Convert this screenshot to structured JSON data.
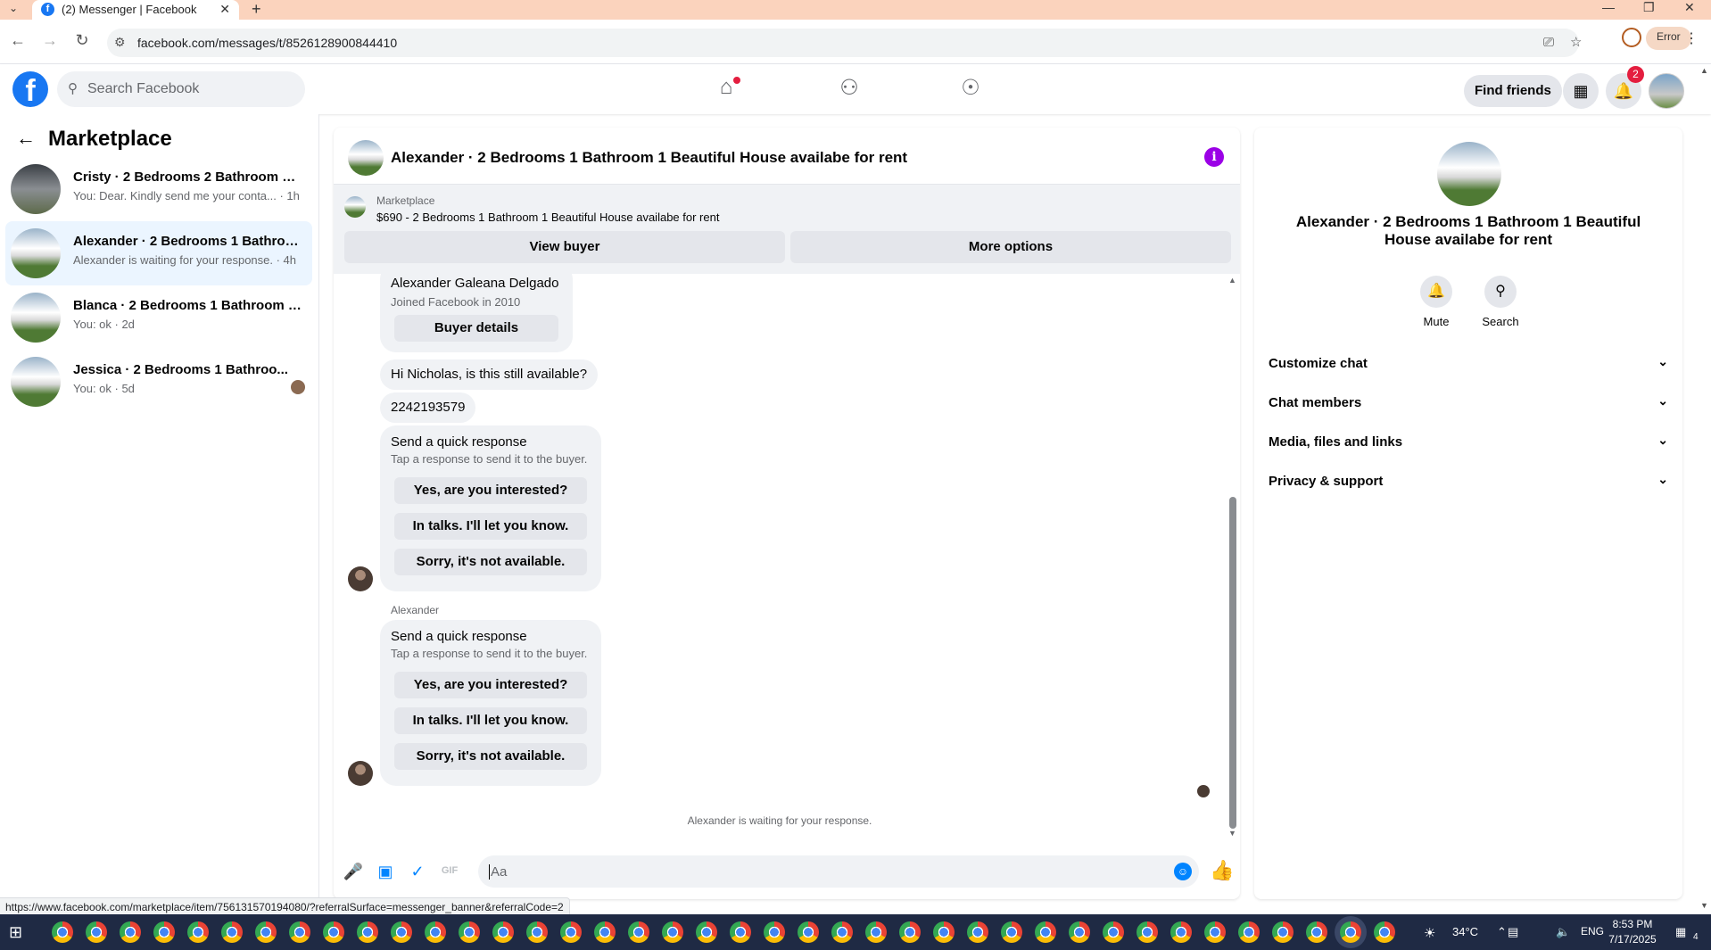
{
  "browser": {
    "tab_title": "(2) Messenger | Facebook",
    "url": "facebook.com/messages/t/8526128900844410",
    "error_label": "Error",
    "status_url": "https://www.facebook.com/marketplace/item/756131570194080/?referralSurface=messenger_banner&referralCode=2"
  },
  "fb_header": {
    "search_placeholder": "Search Facebook",
    "find_friends": "Find friends",
    "notification_count": "2"
  },
  "sidebar": {
    "title": "Marketplace",
    "conversations": [
      {
        "name": "Cristy · 2 Bedrooms 2 Bathroom 1 ...",
        "preview": "You: Dear. Kindly send me your conta... · 1h"
      },
      {
        "name": "Alexander · 2 Bedrooms 1 Bathroo...",
        "preview": "Alexander is waiting for your response. · 4h"
      },
      {
        "name": "Blanca · 2 Bedrooms 1 Bathroom 1 ...",
        "preview": "You: ok · 2d"
      },
      {
        "name": "Jessica · 2 Bedrooms 1 Bathroo...",
        "preview": "You: ok · 5d"
      }
    ]
  },
  "chat": {
    "title": "Alexander · 2 Bedrooms 1 Bathroom 1 Beautiful House availabe for rent",
    "banner": {
      "source": "Marketplace",
      "description": "$690 - 2 Bedrooms 1 Bathroom 1 Beautiful House availabe for rent",
      "view_buyer": "View buyer",
      "more_options": "More options"
    },
    "buyer_card": {
      "name": "Alexander Galeana Delgado",
      "joined": "Joined Facebook in 2010",
      "button": "Buyer details"
    },
    "messages": [
      "Hi Nicholas, is this still available?",
      "2242193579"
    ],
    "quick_response": {
      "title": "Send a quick response",
      "subtitle": "Tap a response to send it to the buyer.",
      "options": [
        "Yes, are you interested?",
        "In talks. I'll let you know.",
        "Sorry, it's not available."
      ]
    },
    "sender_name": "Alexander",
    "waiting": "Alexander is waiting for your response.",
    "composer_placeholder": "Aa",
    "gif_label": "GIF"
  },
  "info_panel": {
    "title": "Alexander · 2 Bedrooms 1 Bathroom 1 Beautiful House availabe for rent",
    "actions": [
      "Mute",
      "Search"
    ],
    "sections": [
      "Customize chat",
      "Chat members",
      "Media, files and links",
      "Privacy & support"
    ]
  },
  "taskbar": {
    "weather": "34°C",
    "language": "ENG",
    "time": "8:53 PM",
    "date": "7/17/2025",
    "notification_count": "4"
  },
  "colors": {
    "fb_blue": "#1877f2",
    "messenger_blue": "#0084ff",
    "info_purple": "#9b00e6",
    "tabstrip": "#fbd3bd"
  }
}
